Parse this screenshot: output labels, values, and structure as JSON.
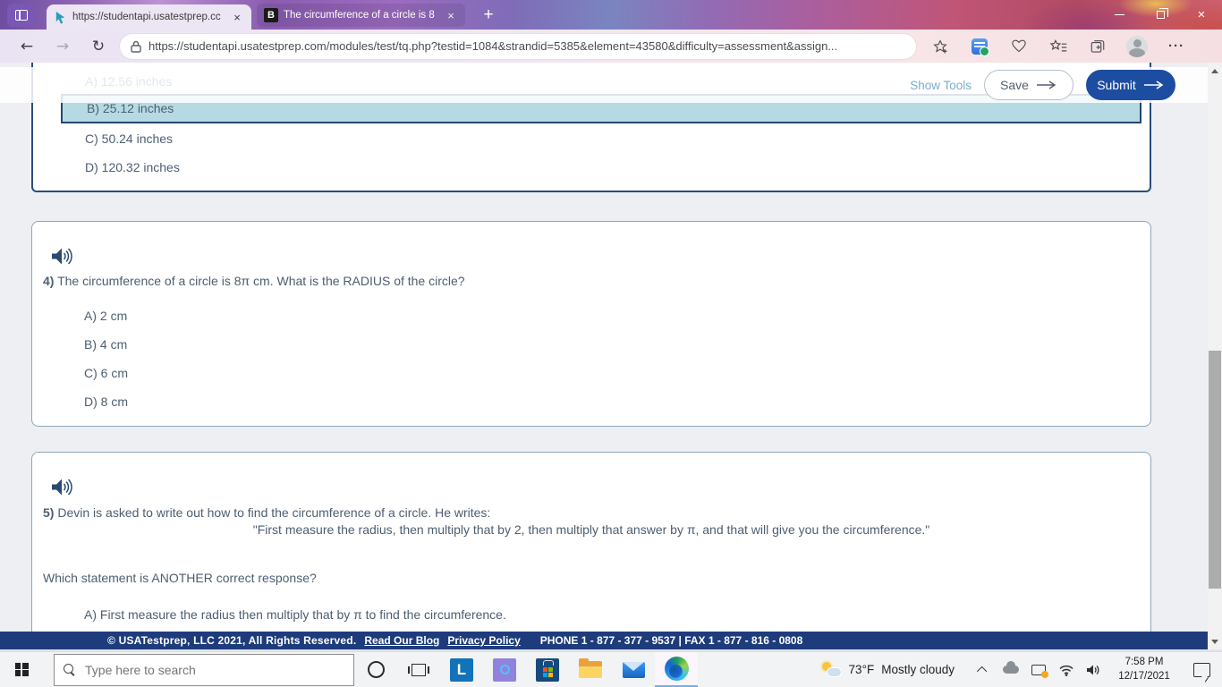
{
  "browser": {
    "tabs": [
      {
        "title": "https://studentapi.usatestprep.cc",
        "close_glyph": "×"
      },
      {
        "title": "The circumference of a circle is 8",
        "favicon_letter": "B",
        "close_glyph": "×"
      }
    ],
    "new_tab_glyph": "+",
    "nav": {
      "back_glyph": "←",
      "forward_glyph": "→",
      "reload_glyph": "↻"
    },
    "url": "https://studentapi.usatestprep.com/modules/test/tq.php?testid=1084&strandid=5385&element=43580&difficulty=assessment&assign...",
    "menu_glyph": "···",
    "window_close_glyph": "×"
  },
  "quiz": {
    "toolbar": {
      "show_tools_label": "Show Tools",
      "save_label": "Save",
      "submit_label": "Submit"
    },
    "question3": {
      "options": [
        {
          "label": "A) 12.56 inches",
          "state": "faded"
        },
        {
          "label": "B) 25.12 inches",
          "state": "selected"
        },
        {
          "label": "C) 50.24 inches",
          "state": "normal"
        },
        {
          "label": "D) 120.32 inches",
          "state": "normal"
        }
      ]
    },
    "question4": {
      "number": "4)",
      "text": "The circumference of a circle is 8π cm. What is the RADIUS of the circle?",
      "options": [
        {
          "label": "A) 2 cm"
        },
        {
          "label": "B) 4 cm"
        },
        {
          "label": "C) 6 cm"
        },
        {
          "label": "D) 8 cm"
        }
      ]
    },
    "question5": {
      "number": "5)",
      "intro": "Devin is asked to write out how to find the circumference of a circle. He writes:",
      "quote": "\"First measure the radius, then multiply that by 2, then multiply that answer by π, and that will give you the circumference.\"",
      "prompt": "Which statement is ANOTHER correct response?",
      "options": [
        {
          "label": "A) First measure the radius then multiply that by π to find the circumference."
        }
      ]
    },
    "colors": {
      "selected_option_bg": "#b5dae4",
      "selected_option_border": "#23486f",
      "submit_bg": "#1d4da1",
      "link_blue": "#79aecd"
    }
  },
  "page_footer": {
    "copyright": "© USATestprep, LLC 2021, All Rights Reserved.",
    "blog_link": "Read Our Blog",
    "privacy_link": "Privacy Policy",
    "phone": "PHONE 1 - 877 - 377 - 9537 | FAX 1 - 877 - 816 - 0808",
    "bg_color": "#1e3c7c"
  },
  "taskbar": {
    "search_placeholder": "Type here to search",
    "weather": {
      "temp": "73°F",
      "condition": "Mostly cloudy"
    },
    "clock": {
      "time": "7:58 PM",
      "date": "12/17/2021"
    }
  }
}
